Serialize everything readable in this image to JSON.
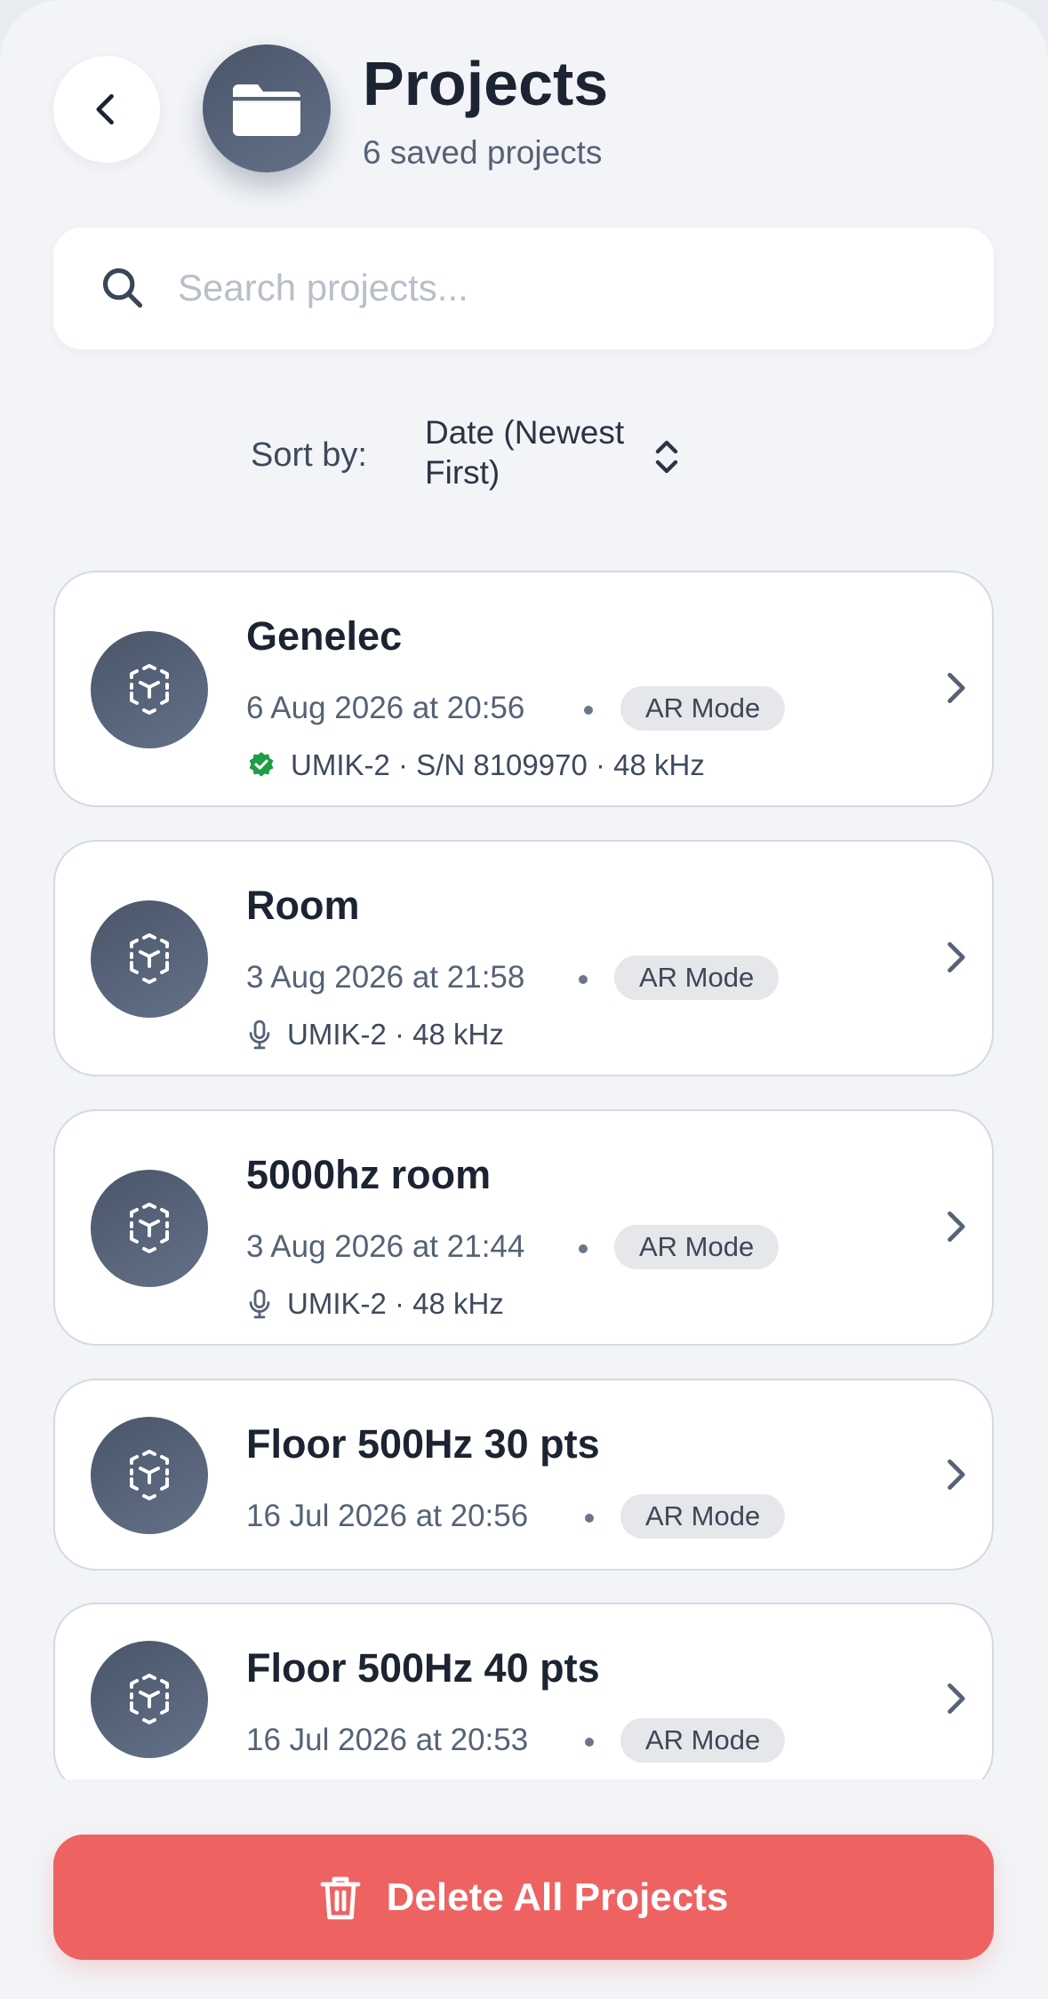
{
  "header": {
    "title": "Projects",
    "subtitle": "6 saved projects",
    "back_icon": "chevron-left-icon",
    "folder_icon": "folder-icon"
  },
  "search": {
    "placeholder": "Search projects...",
    "value": "",
    "icon": "search-icon"
  },
  "sort": {
    "label": "Sort by:",
    "value": "Date (Newest First)",
    "icon": "chevron-up-down-icon"
  },
  "projects": [
    {
      "name": "Genelec",
      "date": "6 Aug 2026 at 20:56",
      "tag": "AR Mode",
      "device": "UMIK-2 · S/N 8109970 · 48 kHz",
      "device_icon": "verified-badge-icon"
    },
    {
      "name": "Room",
      "date": "3 Aug 2026 at 21:58",
      "tag": "AR Mode",
      "device": "UMIK-2 · 48 kHz",
      "device_icon": "microphone-icon"
    },
    {
      "name": "5000hz room",
      "date": "3 Aug 2026 at 21:44",
      "tag": "AR Mode",
      "device": "UMIK-2 · 48 kHz",
      "device_icon": "microphone-icon"
    },
    {
      "name": "Floor 500Hz 30 pts",
      "date": "16 Jul 2026 at 20:56",
      "tag": "AR Mode"
    },
    {
      "name": "Floor 500Hz 40 pts",
      "date": "16 Jul 2026 at 20:53",
      "tag": "AR Mode"
    }
  ],
  "actions": {
    "delete_all_label": "Delete All Projects",
    "delete_icon": "trash-icon"
  },
  "colors": {
    "accent_dark": "#4a5569",
    "danger": "#ef6262",
    "verified": "#1e9e45",
    "background": "#f2f4f7"
  }
}
